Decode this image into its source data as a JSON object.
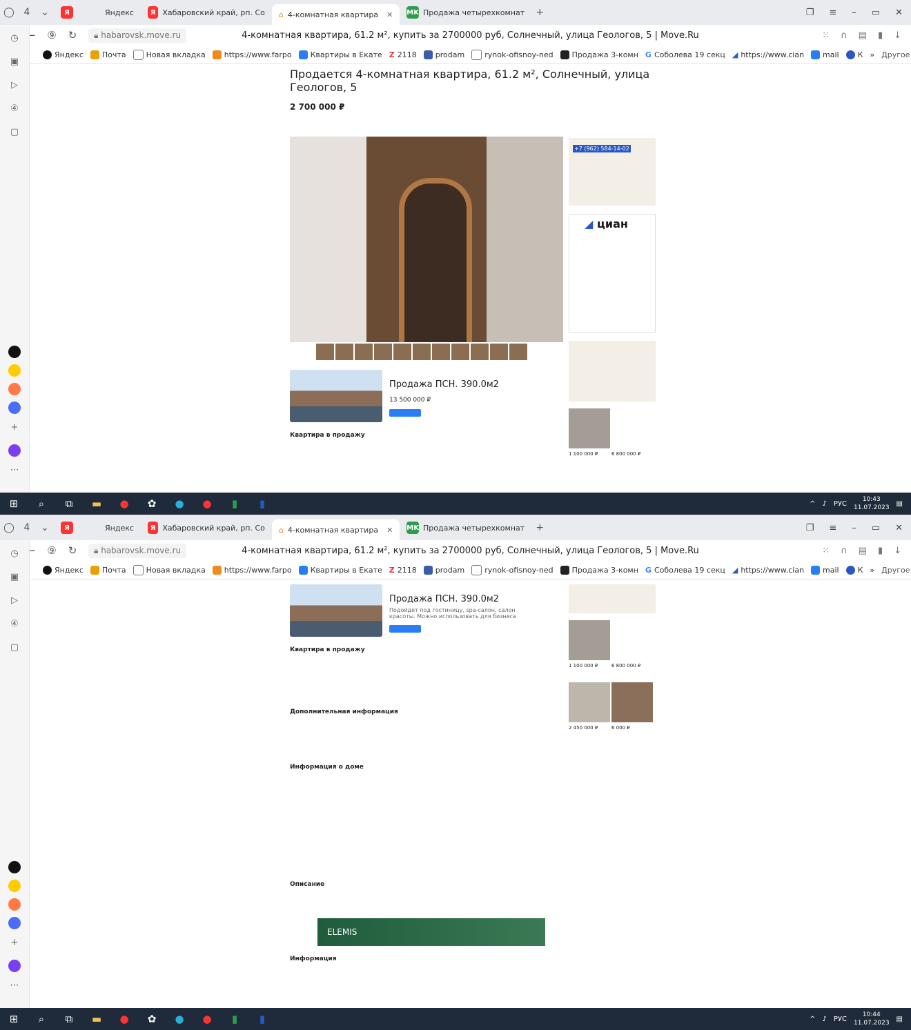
{
  "browser": {
    "tab_count": "4",
    "tabs": [
      {
        "label": "Яндекс"
      },
      {
        "label": "Хабаровский край, рп. Со"
      },
      {
        "label": "4-комнатная квартира"
      },
      {
        "label": "Продажа четырехкомнат"
      }
    ],
    "url": "habarovsk.move.ru",
    "page_title": "4-комнатная квартира, 61.2 м², купить за 2700000 руб, Солнечный, улица Геологов, 5 | Move.Ru",
    "bookmarks": [
      "Яндекс",
      "Почта",
      "Новая вкладка",
      "https://www.farpo",
      "Квартиры в Екате",
      "2118",
      "prodam",
      "rynok-ofisnoy-ned",
      "Продажа 3-комн",
      "Соболева 19 секц",
      "https://www.cian",
      "mail",
      "К"
    ],
    "bookmarks_more": "Другое"
  },
  "page": {
    "heading": "Продается 4-комнатная квартира, 61.2 м², Солнечный, улица Геологов, 5",
    "price": "2 700 000 ₽",
    "phone": "+7 (962) 584-14-02",
    "ad_title": "Продажа ПСН. 390.0м2",
    "ad_price": "13 500 000 ₽",
    "ad_desc": "Подойдет под гостиницу, spa-салон, салон красоты. Можно использовать для бизнеса",
    "section_sale": "Квартира в продажу",
    "section_extra": "Дополнительная информация",
    "section_house": "Информация о доме",
    "section_desc": "Описание",
    "section_info": "Информация",
    "cian_logo": "циан",
    "listing_prices": [
      "1 100 000 ₽",
      "6 800 000 ₽"
    ],
    "listing_prices2": [
      "2 450 000 ₽",
      "6 000 ₽"
    ],
    "banner_brand": "ELEMIS"
  },
  "taskbar": {
    "lang": "РУС",
    "time_top": "10:43",
    "time_bottom": "10:44",
    "date": "11.07.2023"
  },
  "colors": {
    "accent": "#2a57c7",
    "taskbar": "#1f2b3a"
  }
}
